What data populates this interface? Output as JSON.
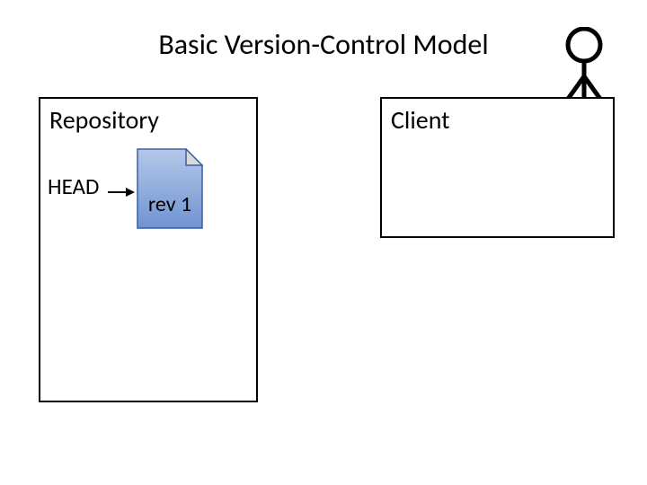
{
  "title": "Basic Version-Control Model",
  "repository": {
    "label": "Repository",
    "head_label": "HEAD",
    "revision_label": "rev 1"
  },
  "client": {
    "label": "Client"
  },
  "colors": {
    "doc_fill_top": "#b5c8e8",
    "doc_fill_bottom": "#6f93d2",
    "doc_fold": "#d9d9d9",
    "stroke": "#3a5fa0"
  }
}
